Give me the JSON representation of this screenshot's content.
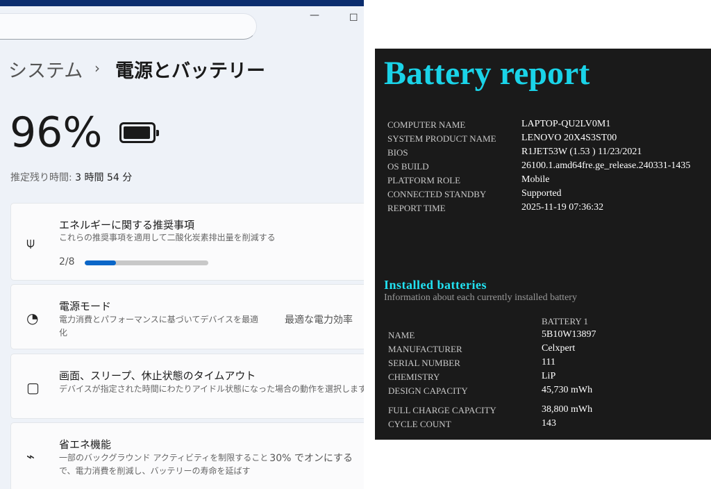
{
  "settings": {
    "breadcrumb": {
      "parent": "システム",
      "separator": "›",
      "current": "電源とバッテリー"
    },
    "window_controls": {
      "minimize": "—",
      "maximize": "☐"
    },
    "battery_percent": "96%",
    "battery_level": 0.96,
    "remaining_label": "推定残り時間:",
    "remaining_value": "3 時間 54 分",
    "cards": [
      {
        "icon": "leaf-icon",
        "title": "エネルギーに関する推奨事項",
        "desc": "これらの推奨事項を適用して二酸化炭素排出量を削減する",
        "progress_label": "2/8",
        "progress": 0.25
      },
      {
        "icon": "gauge-icon",
        "title": "電源モード",
        "desc": "電力消費とパフォーマンスに基づいてデバイスを最適化",
        "value": "最適な電力効率"
      },
      {
        "icon": "screen-sleep-icon",
        "title": "画面、スリープ、休止状態のタイムアウト",
        "desc": "デバイスが指定された時間にわたりアイドル状態になった場合の動作を選択します"
      },
      {
        "icon": "battery-saver-icon",
        "title": "省エネ機能",
        "desc": "一部のバックグラウンド アクティビティを制限することで、電力消費を削減し、バッテリーの寿命を延ばす",
        "value": "30% でオンにする"
      }
    ]
  },
  "report": {
    "title": "Battery report",
    "system": [
      {
        "label": "COMPUTER NAME",
        "value": "LAPTOP-QU2LV0M1"
      },
      {
        "label": "SYSTEM PRODUCT NAME",
        "value": "LENOVO 20X4S3ST00"
      },
      {
        "label": "BIOS",
        "value": "R1JET53W (1.53 ) 11/23/2021"
      },
      {
        "label": "OS BUILD",
        "value": "26100.1.amd64fre.ge_release.240331-1435"
      },
      {
        "label": "PLATFORM ROLE",
        "value": "Mobile"
      },
      {
        "label": "CONNECTED STANDBY",
        "value": "Supported"
      },
      {
        "label": "REPORT TIME",
        "value": "2025-11-19    07:36:32"
      }
    ],
    "installed_title": "Installed batteries",
    "installed_sub": "Information about each currently installed battery",
    "battery_header": "BATTERY 1",
    "battery": [
      {
        "label": "NAME",
        "value": "5B10W13897"
      },
      {
        "label": "MANUFACTURER",
        "value": "Celxpert"
      },
      {
        "label": "SERIAL NUMBER",
        "value": "111"
      },
      {
        "label": "CHEMISTRY",
        "value": "LiP"
      },
      {
        "label": "DESIGN CAPACITY",
        "value": "45,730 mWh"
      },
      {
        "label": "FULL CHARGE CAPACITY",
        "value": "38,800 mWh"
      },
      {
        "label": "CYCLE COUNT",
        "value": "143"
      }
    ],
    "colors": {
      "accent": "#1ad3e8",
      "background": "#1a1a1a"
    }
  }
}
